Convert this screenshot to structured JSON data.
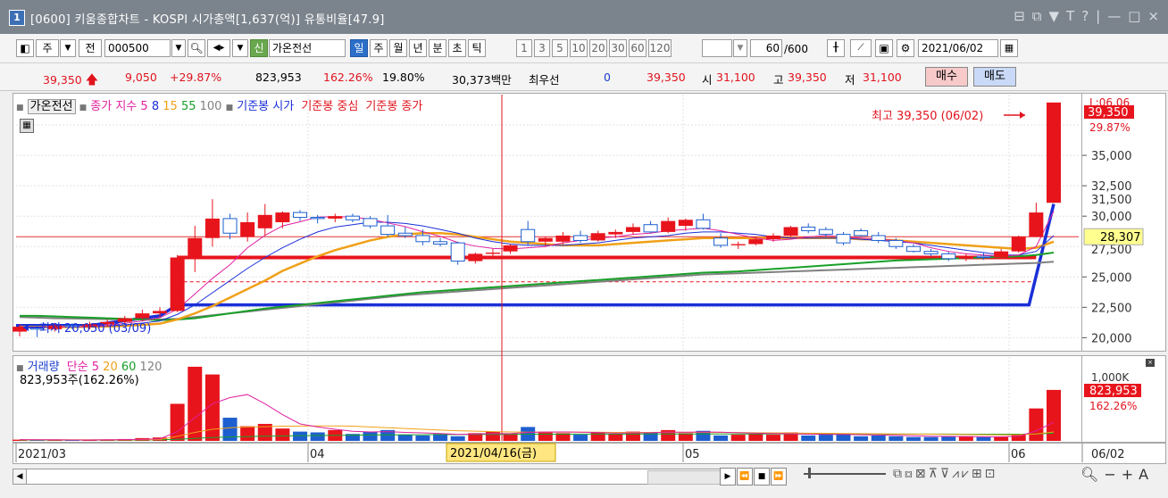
{
  "window": {
    "num": "1",
    "title": "[0600] 키움종합차트 - KOSPI 시가총액[1,637(억)] 유통비율[47.9]",
    "controls": [
      "⊟",
      "⧉",
      "▼",
      "T",
      "?",
      "|",
      "—",
      "□",
      "×"
    ]
  },
  "toolbar": {
    "period_unit": "주",
    "prev": "전",
    "code": "000500",
    "badge_new": "신",
    "stock_name": "가온전선",
    "tabs": [
      "일",
      "주",
      "월",
      "년",
      "분",
      "초",
      "틱"
    ],
    "active_tab": "일",
    "intervals": [
      "1",
      "3",
      "5",
      "10",
      "20",
      "30",
      "60",
      "120"
    ],
    "count": "60",
    "count_total": "/600",
    "date": "2021/06/02"
  },
  "quote": {
    "price": "39,350",
    "change": "9,050",
    "change_pct": "+29.87%",
    "volume": "823,953",
    "volume_pct": "162.26%",
    "turnover": "19.80%",
    "amount": "30,373백만",
    "best_label": "최우선",
    "best_qty": "0",
    "best_price": "39,350",
    "open_label": "시",
    "open": "31,100",
    "high_label": "고",
    "high": "39,350",
    "low_label": "저",
    "low": "31,100",
    "buy": "매수",
    "sell": "매도"
  },
  "legend_price": {
    "name": "가온전선",
    "ma_label": "종가 지수",
    "ma": [
      "5",
      "8",
      "15",
      "55",
      "100"
    ],
    "ref_open": "기준봉 시가",
    "ref_mid": "기준봉 중심",
    "ref_close": "기준봉 종가"
  },
  "legend_vol": {
    "label": "거래량",
    "ma_label": "단순",
    "ma": [
      "5",
      "20",
      "60",
      "120"
    ],
    "value": "823,953주(162.26%)"
  },
  "annotations": {
    "high": "최고 39,350 (06/02)",
    "low": "최저 20,050 (03/09)",
    "cursor_date": "2021/04/16(금)"
  },
  "price_axis": {
    "ticks": [
      "35,000",
      "32,500",
      "30,000",
      "25,000",
      "22,500",
      "20,000"
    ],
    "top_label": "L:06.06",
    "current": "39,350",
    "current_pct": "29.87%",
    "hline_label": "28,307",
    "hidden_label": "31,500",
    "hidden_label2": "27,500"
  },
  "vol_axis": {
    "tick": "1,000K",
    "current": "823,953",
    "current_pct": "162.26%"
  },
  "x_axis": {
    "labels": [
      "2021/03",
      "04",
      "05",
      "06"
    ],
    "right": "06/02"
  },
  "colors": {
    "up": "#e8141c",
    "down": "#1d5fd0",
    "ma5": "#e020a0",
    "ma8": "#1a2fd8",
    "ma15": "#f0a018",
    "ma55": "#18a028",
    "ma100": "#808080",
    "ref": "#e8141c"
  },
  "chart_data": {
    "type": "candlestick",
    "ylim": [
      19000,
      40000
    ],
    "candles": [
      {
        "o": 20500,
        "h": 21100,
        "l": 20100,
        "c": 20900
      },
      {
        "o": 20800,
        "h": 21100,
        "l": 20050,
        "c": 20700
      },
      {
        "o": 20700,
        "h": 21200,
        "l": 20500,
        "c": 21000
      },
      {
        "o": 21000,
        "h": 21200,
        "l": 20700,
        "c": 20900
      },
      {
        "o": 20900,
        "h": 21300,
        "l": 20700,
        "c": 21100
      },
      {
        "o": 21100,
        "h": 21500,
        "l": 20900,
        "c": 21300
      },
      {
        "o": 21300,
        "h": 21800,
        "l": 21100,
        "c": 21600
      },
      {
        "o": 21600,
        "h": 22300,
        "l": 21400,
        "c": 22000
      },
      {
        "o": 22000,
        "h": 22500,
        "l": 21700,
        "c": 22200
      },
      {
        "o": 22200,
        "h": 26800,
        "l": 22100,
        "c": 26600
      },
      {
        "o": 26600,
        "h": 29200,
        "l": 25400,
        "c": 28200
      },
      {
        "o": 28200,
        "h": 31400,
        "l": 27500,
        "c": 29800
      },
      {
        "o": 29800,
        "h": 30200,
        "l": 28100,
        "c": 28600
      },
      {
        "o": 28300,
        "h": 30300,
        "l": 27900,
        "c": 29500
      },
      {
        "o": 29000,
        "h": 31000,
        "l": 28400,
        "c": 30100
      },
      {
        "o": 29500,
        "h": 30400,
        "l": 29000,
        "c": 30300
      },
      {
        "o": 30300,
        "h": 30500,
        "l": 29600,
        "c": 29900
      },
      {
        "o": 29900,
        "h": 30100,
        "l": 29400,
        "c": 29800
      },
      {
        "o": 29800,
        "h": 30200,
        "l": 29500,
        "c": 30000
      },
      {
        "o": 30000,
        "h": 30200,
        "l": 29500,
        "c": 29700
      },
      {
        "o": 29800,
        "h": 30000,
        "l": 29000,
        "c": 29200
      },
      {
        "o": 29200,
        "h": 30100,
        "l": 28300,
        "c": 28500
      },
      {
        "o": 28600,
        "h": 29100,
        "l": 28200,
        "c": 28400
      },
      {
        "o": 28400,
        "h": 28900,
        "l": 27600,
        "c": 27900
      },
      {
        "o": 27900,
        "h": 28200,
        "l": 27500,
        "c": 27700
      },
      {
        "o": 27800,
        "h": 27900,
        "l": 26000,
        "c": 26300
      },
      {
        "o": 26300,
        "h": 27000,
        "l": 26100,
        "c": 26900
      },
      {
        "o": 26900,
        "h": 27300,
        "l": 26600,
        "c": 27000
      },
      {
        "o": 27100,
        "h": 27700,
        "l": 26900,
        "c": 27600
      },
      {
        "o": 28900,
        "h": 29600,
        "l": 27600,
        "c": 27900
      },
      {
        "o": 27900,
        "h": 28300,
        "l": 27500,
        "c": 28200
      },
      {
        "o": 27900,
        "h": 28700,
        "l": 27700,
        "c": 28400
      },
      {
        "o": 28400,
        "h": 28800,
        "l": 27800,
        "c": 28000
      },
      {
        "o": 28000,
        "h": 28800,
        "l": 27900,
        "c": 28600
      },
      {
        "o": 28500,
        "h": 28900,
        "l": 28200,
        "c": 28700
      },
      {
        "o": 28700,
        "h": 29400,
        "l": 28500,
        "c": 29100
      },
      {
        "o": 29300,
        "h": 29600,
        "l": 28600,
        "c": 28700
      },
      {
        "o": 28700,
        "h": 29900,
        "l": 28600,
        "c": 29600
      },
      {
        "o": 29200,
        "h": 29800,
        "l": 28800,
        "c": 29700
      },
      {
        "o": 29700,
        "h": 30200,
        "l": 28900,
        "c": 29000
      },
      {
        "o": 28200,
        "h": 28600,
        "l": 27400,
        "c": 27600
      },
      {
        "o": 27600,
        "h": 27900,
        "l": 27300,
        "c": 27700
      },
      {
        "o": 27700,
        "h": 28300,
        "l": 27600,
        "c": 28100
      },
      {
        "o": 28100,
        "h": 28600,
        "l": 27900,
        "c": 28400
      },
      {
        "o": 28400,
        "h": 29200,
        "l": 28300,
        "c": 29100
      },
      {
        "o": 29100,
        "h": 29400,
        "l": 28600,
        "c": 28800
      },
      {
        "o": 28900,
        "h": 29100,
        "l": 28300,
        "c": 28500
      },
      {
        "o": 28500,
        "h": 28700,
        "l": 27600,
        "c": 27800
      },
      {
        "o": 28800,
        "h": 29000,
        "l": 28300,
        "c": 28400
      },
      {
        "o": 28400,
        "h": 28700,
        "l": 27800,
        "c": 28000
      },
      {
        "o": 28000,
        "h": 28200,
        "l": 27300,
        "c": 27500
      },
      {
        "o": 27500,
        "h": 27700,
        "l": 27000,
        "c": 27100
      },
      {
        "o": 27100,
        "h": 27300,
        "l": 26700,
        "c": 26900
      },
      {
        "o": 26900,
        "h": 27100,
        "l": 26300,
        "c": 26500
      },
      {
        "o": 26500,
        "h": 26900,
        "l": 26300,
        "c": 26700
      },
      {
        "o": 26700,
        "h": 27000,
        "l": 26400,
        "c": 26600
      },
      {
        "o": 26600,
        "h": 27300,
        "l": 26500,
        "c": 27100
      },
      {
        "o": 27100,
        "h": 28400,
        "l": 27000,
        "c": 28300
      },
      {
        "o": 28300,
        "h": 31100,
        "l": 28300,
        "c": 30300
      },
      {
        "o": 31100,
        "h": 39350,
        "l": 31100,
        "c": 39350
      }
    ],
    "ma5": [
      20900,
      20850,
      20870,
      20880,
      20920,
      21000,
      21180,
      21380,
      21640,
      22340,
      23600,
      24880,
      26000,
      27400,
      28420,
      29200,
      29540,
      29920,
      29960,
      29920,
      29760,
      29440,
      29140,
      28720,
      28340,
      27830,
      27540,
      27340,
      27300,
      27400,
      27500,
      27800,
      28000,
      28200,
      28300,
      28500,
      28600,
      28800,
      28900,
      29000,
      28800,
      28500,
      28200,
      28000,
      28100,
      28300,
      28400,
      28300,
      28200,
      28100,
      28000,
      27800,
      27400,
      27100,
      26900,
      26800,
      26700,
      26800,
      27500,
      30400
    ],
    "ma8": [
      20900,
      20880,
      20880,
      20880,
      20900,
      20960,
      21060,
      21200,
      21380,
      21920,
      22700,
      23700,
      24700,
      25700,
      26600,
      27400,
      28100,
      28700,
      29100,
      29300,
      29500,
      29500,
      29400,
      29200,
      28900,
      28600,
      28200,
      27900,
      27700,
      27600,
      27600,
      27600,
      27700,
      27800,
      28000,
      28200,
      28300,
      28400,
      28600,
      28700,
      28700,
      28600,
      28500,
      28300,
      28200,
      28200,
      28200,
      28200,
      28100,
      28000,
      27900,
      27800,
      27600,
      27400,
      27200,
      27000,
      26800,
      26800,
      27100,
      28400
    ],
    "ma15": [
      20900,
      20880,
      20880,
      20880,
      20900,
      20920,
      20980,
      21060,
      21160,
      21500,
      22000,
      22600,
      23300,
      24000,
      24700,
      25500,
      26100,
      26700,
      27200,
      27600,
      28000,
      28300,
      28500,
      28600,
      28600,
      28500,
      28300,
      28100,
      27900,
      27800,
      27700,
      27600,
      27600,
      27600,
      27700,
      27800,
      27900,
      28000,
      28100,
      28200,
      28200,
      28200,
      28200,
      28200,
      28200,
      28200,
      28200,
      28200,
      28100,
      28100,
      28000,
      27900,
      27800,
      27700,
      27600,
      27500,
      27400,
      27300,
      27400,
      27900
    ],
    "ma55": [
      21800,
      21800,
      21750,
      21700,
      21650,
      21600,
      21550,
      21500,
      21450,
      21500,
      21600,
      21800,
      22000,
      22200,
      22400,
      22550,
      22700,
      22850,
      23000,
      23150,
      23300,
      23450,
      23600,
      23750,
      23850,
      23950,
      24050,
      24150,
      24250,
      24350,
      24450,
      24550,
      24650,
      24750,
      24850,
      24950,
      25050,
      25150,
      25250,
      25350,
      25400,
      25450,
      25550,
      25650,
      25750,
      25850,
      25950,
      26050,
      26150,
      26250,
      26350,
      26400,
      26450,
      26500,
      26550,
      26600,
      26650,
      26700,
      26800,
      27000
    ],
    "ma100": [
      21700,
      21650,
      21600,
      21580,
      21550,
      21520,
      21500,
      21500,
      21500,
      21550,
      21700,
      21850,
      22000,
      22150,
      22300,
      22450,
      22600,
      22750,
      22900,
      23050,
      23200,
      23350,
      23500,
      23600,
      23700,
      23800,
      23900,
      24000,
      24100,
      24200,
      24300,
      24400,
      24500,
      24600,
      24700,
      24800,
      24900,
      25000,
      25100,
      25200,
      25250,
      25300,
      25350,
      25400,
      25450,
      25500,
      25550,
      25600,
      25650,
      25700,
      25750,
      25800,
      25850,
      25900,
      25950,
      26000,
      26050,
      26100,
      26150,
      26250
    ],
    "ref_open": 22700,
    "ref_mid": 24600,
    "ref_close": 26600,
    "hline": 28307,
    "volume": [
      8,
      6,
      7,
      5,
      6,
      9,
      12,
      18,
      22,
      240,
      480,
      430,
      150,
      95,
      110,
      80,
      60,
      55,
      70,
      45,
      60,
      70,
      40,
      35,
      45,
      30,
      50,
      60,
      45,
      90,
      60,
      50,
      40,
      55,
      45,
      60,
      55,
      70,
      50,
      65,
      35,
      40,
      45,
      40,
      55,
      35,
      40,
      45,
      30,
      35,
      30,
      25,
      25,
      30,
      30,
      25,
      25,
      40,
      210,
      330
    ],
    "vol_ma5": [
      8,
      7,
      7,
      6,
      6,
      7,
      8,
      10,
      13,
      60,
      150,
      240,
      280,
      300,
      240,
      170,
      110,
      90,
      75,
      62,
      58,
      60,
      55,
      52,
      48,
      42,
      45,
      48,
      47,
      55,
      57,
      58,
      56,
      54,
      50,
      52,
      53,
      57,
      56,
      58,
      56,
      53,
      50,
      48,
      46,
      43,
      42,
      42,
      40,
      38,
      36,
      33,
      30,
      29,
      28,
      27,
      27,
      30,
      65,
      120
    ],
    "vol_ma20": [
      8,
      7,
      7,
      7,
      7,
      7,
      7,
      8,
      9,
      30,
      55,
      75,
      85,
      90,
      92,
      95,
      96,
      97,
      97,
      95,
      90,
      85,
      80,
      75,
      70,
      66,
      63,
      60,
      58,
      56,
      56,
      56,
      56,
      56,
      55,
      55,
      55,
      56,
      55,
      55,
      54,
      54,
      53,
      52,
      51,
      50,
      49,
      48,
      47,
      46,
      45,
      44,
      43,
      42,
      41,
      40,
      39,
      40,
      45,
      58
    ],
    "vol_ma60": [
      5,
      5,
      5,
      5,
      5,
      5,
      5,
      6,
      7,
      10,
      16,
      22,
      25,
      28,
      30,
      32,
      34,
      35,
      36,
      37,
      38,
      39,
      40,
      40,
      41,
      41,
      42,
      42,
      42,
      43,
      43,
      43,
      44,
      44,
      44,
      44,
      45,
      45,
      45,
      45,
      45,
      45,
      45,
      45,
      45,
      45,
      45,
      45,
      44,
      44,
      44,
      44,
      44,
      44,
      43,
      43,
      43,
      43,
      45,
      50
    ]
  }
}
